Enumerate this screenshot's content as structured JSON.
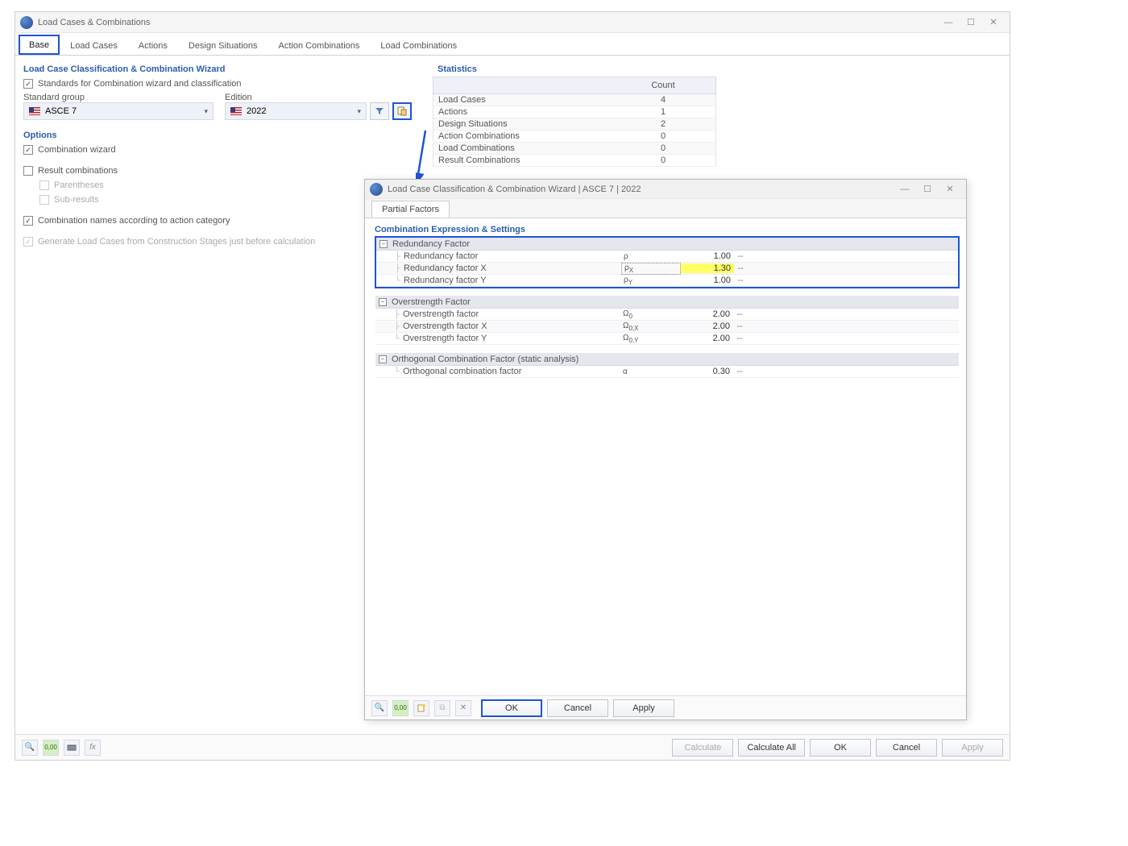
{
  "main": {
    "title": "Load Cases & Combinations",
    "tabs": [
      "Base",
      "Load Cases",
      "Actions",
      "Design Situations",
      "Action Combinations",
      "Load Combinations"
    ],
    "selected_tab": 0,
    "section1": "Load Case Classification & Combination Wizard",
    "chk_standards": "Standards for Combination wizard and classification",
    "lbl_standard_group": "Standard group",
    "val_standard_group": "ASCE 7",
    "lbl_edition": "Edition",
    "val_edition": "2022",
    "section2": "Options",
    "chk_wizard": "Combination wizard",
    "chk_result": "Result combinations",
    "chk_paren": "Parentheses",
    "chk_subres": "Sub-results",
    "chk_names": "Combination names according to action category",
    "chk_generate": "Generate Load Cases from Construction Stages just before calculation",
    "stats_header": "Statistics",
    "col_count": "Count",
    "stats": [
      {
        "name": "Load Cases",
        "count": "4"
      },
      {
        "name": "Actions",
        "count": "1"
      },
      {
        "name": "Design Situations",
        "count": "2"
      },
      {
        "name": "Action Combinations",
        "count": "0"
      },
      {
        "name": "Load Combinations",
        "count": "0"
      },
      {
        "name": "Result Combinations",
        "count": "0"
      }
    ],
    "btn_calc": "Calculate",
    "btn_calc_all": "Calculate All",
    "btn_ok": "OK",
    "btn_cancel": "Cancel",
    "btn_apply": "Apply"
  },
  "dialog": {
    "title": "Load Case Classification & Combination Wizard | ASCE 7 | 2022",
    "tab": "Partial Factors",
    "expr_header": "Combination Expression & Settings",
    "groups": [
      {
        "title": "Redundancy Factor",
        "highlighted": true,
        "rows": [
          {
            "name": "Redundancy factor",
            "sym": "ρ",
            "val": "1.00",
            "unit": "--"
          },
          {
            "name": "Redundancy factor X",
            "sym": "ρX",
            "sym_boxed": true,
            "val": "1.30",
            "val_hl": true,
            "unit": "--"
          },
          {
            "name": "Redundancy factor Y",
            "sym": "ρY",
            "val": "1.00",
            "unit": "--"
          }
        ]
      },
      {
        "title": "Overstrength Factor",
        "rows": [
          {
            "name": "Overstrength factor",
            "sym": "Ω0",
            "val": "2.00",
            "unit": "--"
          },
          {
            "name": "Overstrength factor X",
            "sym": "Ω0,X",
            "val": "2.00",
            "unit": "--"
          },
          {
            "name": "Overstrength factor Y",
            "sym": "Ω0,Y",
            "val": "2.00",
            "unit": "--"
          }
        ]
      },
      {
        "title": "Orthogonal Combination Factor (static analysis)",
        "rows": [
          {
            "name": "Orthogonal combination factor",
            "sym": "α",
            "val": "0.30",
            "unit": "--"
          }
        ]
      }
    ],
    "btn_ok": "OK",
    "btn_cancel": "Cancel",
    "btn_apply": "Apply"
  }
}
